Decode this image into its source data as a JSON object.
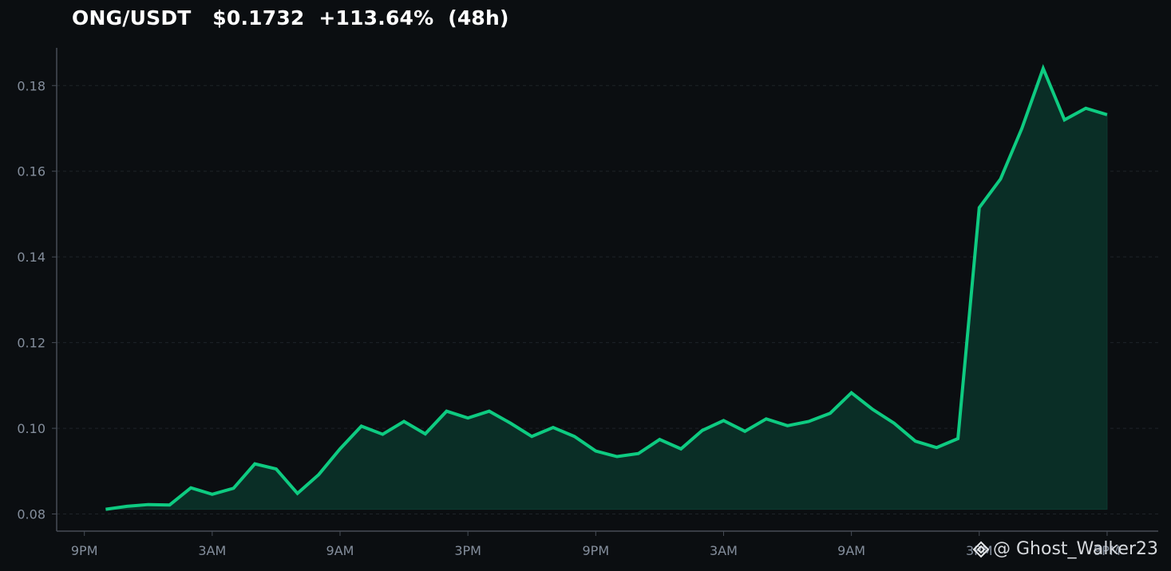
{
  "header": {
    "title": "ONG/USDT   $0.1732  +113.64%  (48h)"
  },
  "watermark": {
    "icon": "binance-logo-icon",
    "text": "@ Ghost_Walker23"
  },
  "colors": {
    "background": "#0b0e11",
    "line": "#0ecb81",
    "area": "#0a2e26",
    "axis": "#474d57",
    "grid": "#1e2329",
    "tick": "#848e9c"
  },
  "chart_data": {
    "type": "area",
    "title": "ONG/USDT   $0.1732  +113.64%  (48h)",
    "xlabel": "",
    "ylabel": "",
    "grid": "horizontal dashed",
    "ylim": [
      0.076,
      0.1888
    ],
    "xlim": [
      -1.3,
      50.4
    ],
    "y_ticks": [
      0.08,
      0.1,
      0.12,
      0.14,
      0.16,
      0.18
    ],
    "y_tick_labels": [
      "0.08",
      "0.10",
      "0.12",
      "0.14",
      "0.16",
      "0.18"
    ],
    "x_ticks": [
      0,
      6,
      12,
      18,
      24,
      30,
      36,
      42,
      48
    ],
    "x_tick_labels": [
      "9PM",
      "3AM",
      "9AM",
      "3PM",
      "9PM",
      "3AM",
      "9AM",
      "3PM",
      "9PM"
    ],
    "series": [
      {
        "x": [
          1,
          2,
          3,
          4,
          5,
          6,
          7,
          8,
          9,
          10,
          11,
          12,
          13,
          14,
          15,
          16,
          17,
          18,
          19,
          20,
          21,
          22,
          23,
          24,
          25,
          26,
          27,
          28,
          29,
          30,
          31,
          32,
          33,
          34,
          35,
          36,
          37,
          38,
          39,
          40,
          41,
          42,
          43,
          44,
          45,
          46,
          47,
          48
        ],
        "values": [
          0.0811,
          0.0818,
          0.0822,
          0.0821,
          0.0861,
          0.0846,
          0.086,
          0.0917,
          0.0905,
          0.0848,
          0.0892,
          0.0952,
          0.1005,
          0.0986,
          0.1016,
          0.0987,
          0.104,
          0.1024,
          0.104,
          0.1012,
          0.0981,
          0.1002,
          0.0981,
          0.0947,
          0.0934,
          0.0941,
          0.0974,
          0.0952,
          0.0995,
          0.1018,
          0.0993,
          0.1022,
          0.1006,
          0.1016,
          0.1035,
          0.1083,
          0.1044,
          0.1012,
          0.097,
          0.0955,
          0.0976,
          0.1515,
          0.1582,
          0.17,
          0.184,
          0.172,
          0.1747,
          0.1732
        ]
      }
    ]
  }
}
